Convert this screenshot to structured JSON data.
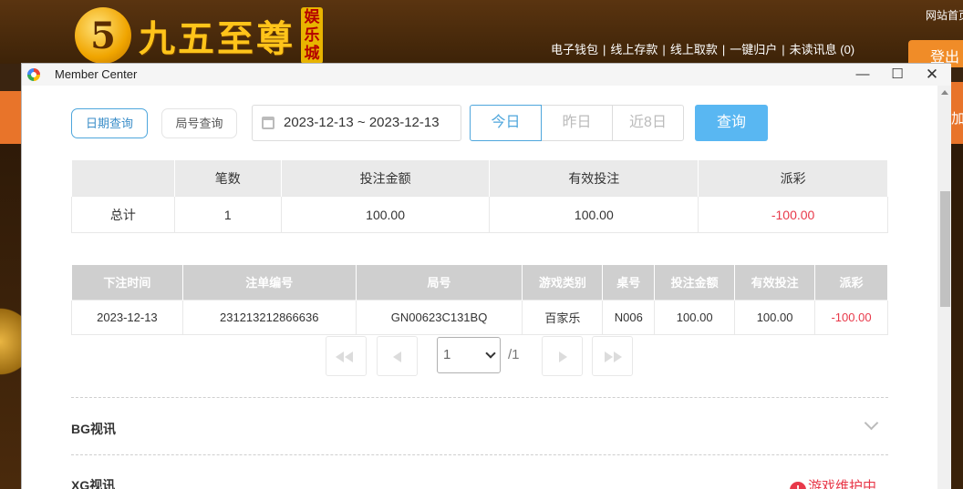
{
  "site": {
    "logo_number": "5",
    "logo_text": "九五至尊",
    "logo_badge": "娱乐城",
    "nav": [
      "电子钱包",
      "线上存款",
      "线上取款",
      "一键归户",
      "未读讯息 (0)"
    ],
    "nav_sep": "|",
    "home": "网站首页",
    "logout": "登出",
    "side_text": "加"
  },
  "window": {
    "title": "Member Center",
    "min": "—",
    "max": "☐",
    "close": "✕"
  },
  "toolbar": {
    "tab_date": "日期查询",
    "tab_round": "局号查询",
    "date_range": "2023-12-13 ~ 2023-12-13",
    "quick": [
      "今日",
      "昨日",
      "近8日"
    ],
    "search": "查询"
  },
  "summary": {
    "headers": [
      "",
      "笔数",
      "投注金额",
      "有效投注",
      "派彩"
    ],
    "row": [
      "总计",
      "1",
      "100.00",
      "100.00",
      "-100.00"
    ]
  },
  "detail": {
    "headers": [
      "下注时间",
      "注单编号",
      "局号",
      "游戏类别",
      "桌号",
      "投注金额",
      "有效投注",
      "派彩"
    ],
    "rows": [
      [
        "2023-12-13",
        "231213212866636",
        "GN00623C131BQ",
        "百家乐",
        "N006",
        "100.00",
        "100.00",
        "-100.00"
      ]
    ]
  },
  "pagination": {
    "page": "1",
    "total": "/1"
  },
  "sections": {
    "bg": "BG视讯",
    "xg": "XG视讯",
    "maintenance": "游戏维护中",
    "maintenance_icon": "!"
  },
  "colors": {
    "accent": "#4ea6dc",
    "search": "#59b7f2",
    "negative": "#e8394a"
  }
}
